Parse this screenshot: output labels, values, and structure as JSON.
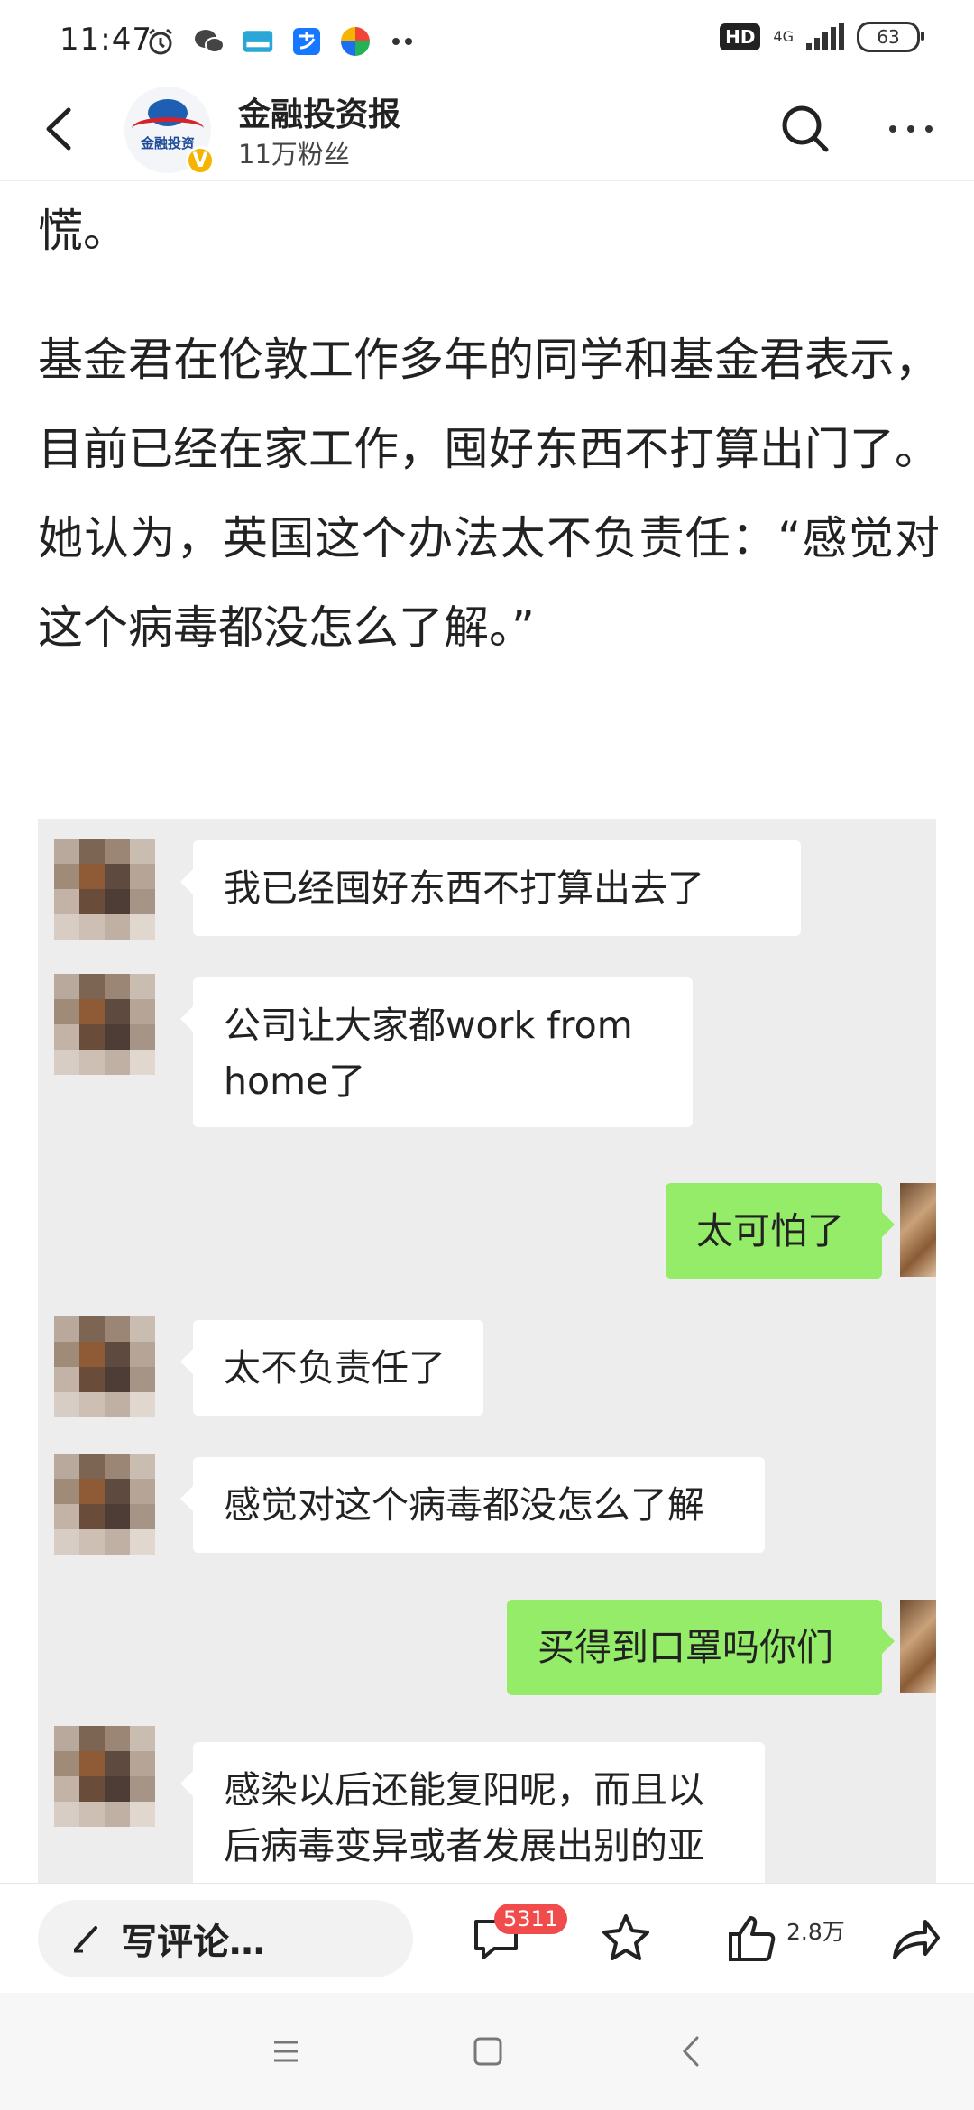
{
  "status_bar": {
    "time": "11:47",
    "hd": "HD",
    "network": "4G",
    "battery": "63"
  },
  "header": {
    "account_name": "金融投资报",
    "followers": "11万粉丝",
    "verified_badge": "V",
    "avatar_text": "金融投资"
  },
  "article": {
    "fragment": "慌。",
    "paragraph": "基金君在伦敦工作多年的同学和基金君表示，目前已经在家工作，囤好东西不打算出门了。她认为，英国这个办法太不负责任：“感觉对这个病毒都没怎么了解。”"
  },
  "chat": {
    "messages": [
      {
        "side": "left",
        "text": "我已经囤好东西不打算出去了"
      },
      {
        "side": "left",
        "text": "公司让大家都work from home了"
      },
      {
        "side": "right",
        "text": "太可怕了"
      },
      {
        "side": "left",
        "text": "太不负责任了"
      },
      {
        "side": "left",
        "text": "感觉对这个病毒都没怎么了解"
      },
      {
        "side": "right",
        "text": "买得到口罩吗你们"
      },
      {
        "side": "left",
        "text": "感染以后还能复阳呢，而且以后病毒变异或者发展出别的亚"
      }
    ]
  },
  "bottom_bar": {
    "comment_placeholder": "写评论…",
    "comment_count": "5311",
    "like_count": "2.8万"
  },
  "colors": {
    "sent_bubble": "#95ec69",
    "received_bubble": "#ffffff",
    "badge_red": "#f14b4b",
    "verified_gold": "#f5b400"
  }
}
